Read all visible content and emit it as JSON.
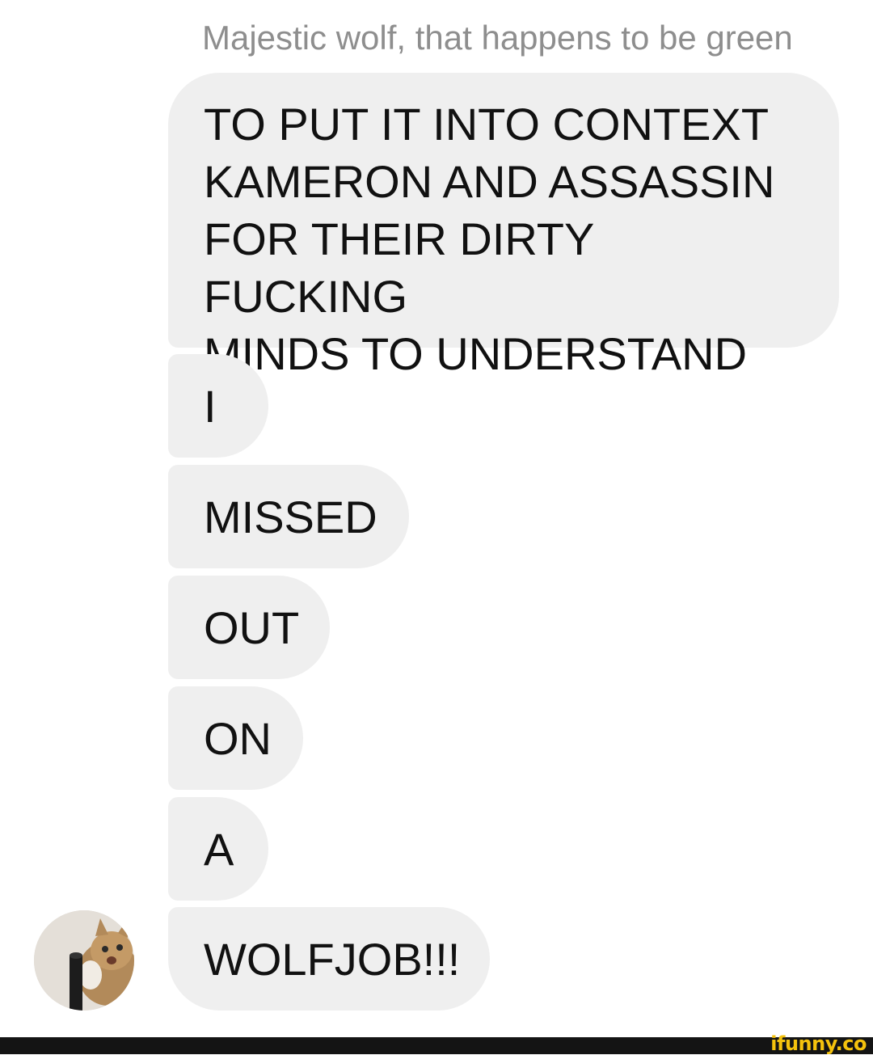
{
  "conversation": {
    "reply_quote": "Majestic wolf, that happens to be green",
    "messages": [
      {
        "text": "TO PUT IT INTO CONTEXT\nKAMERON AND ASSASSIN\nFOR THEIR DIRTY FUCKING\nMINDS TO UNDERSTAND"
      },
      {
        "text": "I"
      },
      {
        "text": "MISSED"
      },
      {
        "text": "OUT"
      },
      {
        "text": "ON"
      },
      {
        "text": "A"
      },
      {
        "text": "WOLFJOB!!!"
      }
    ]
  },
  "watermark": "ifunny.co",
  "colors": {
    "bubble": "#efefef",
    "quote_text": "#8e8e8e",
    "watermark": "#f4c20d"
  }
}
